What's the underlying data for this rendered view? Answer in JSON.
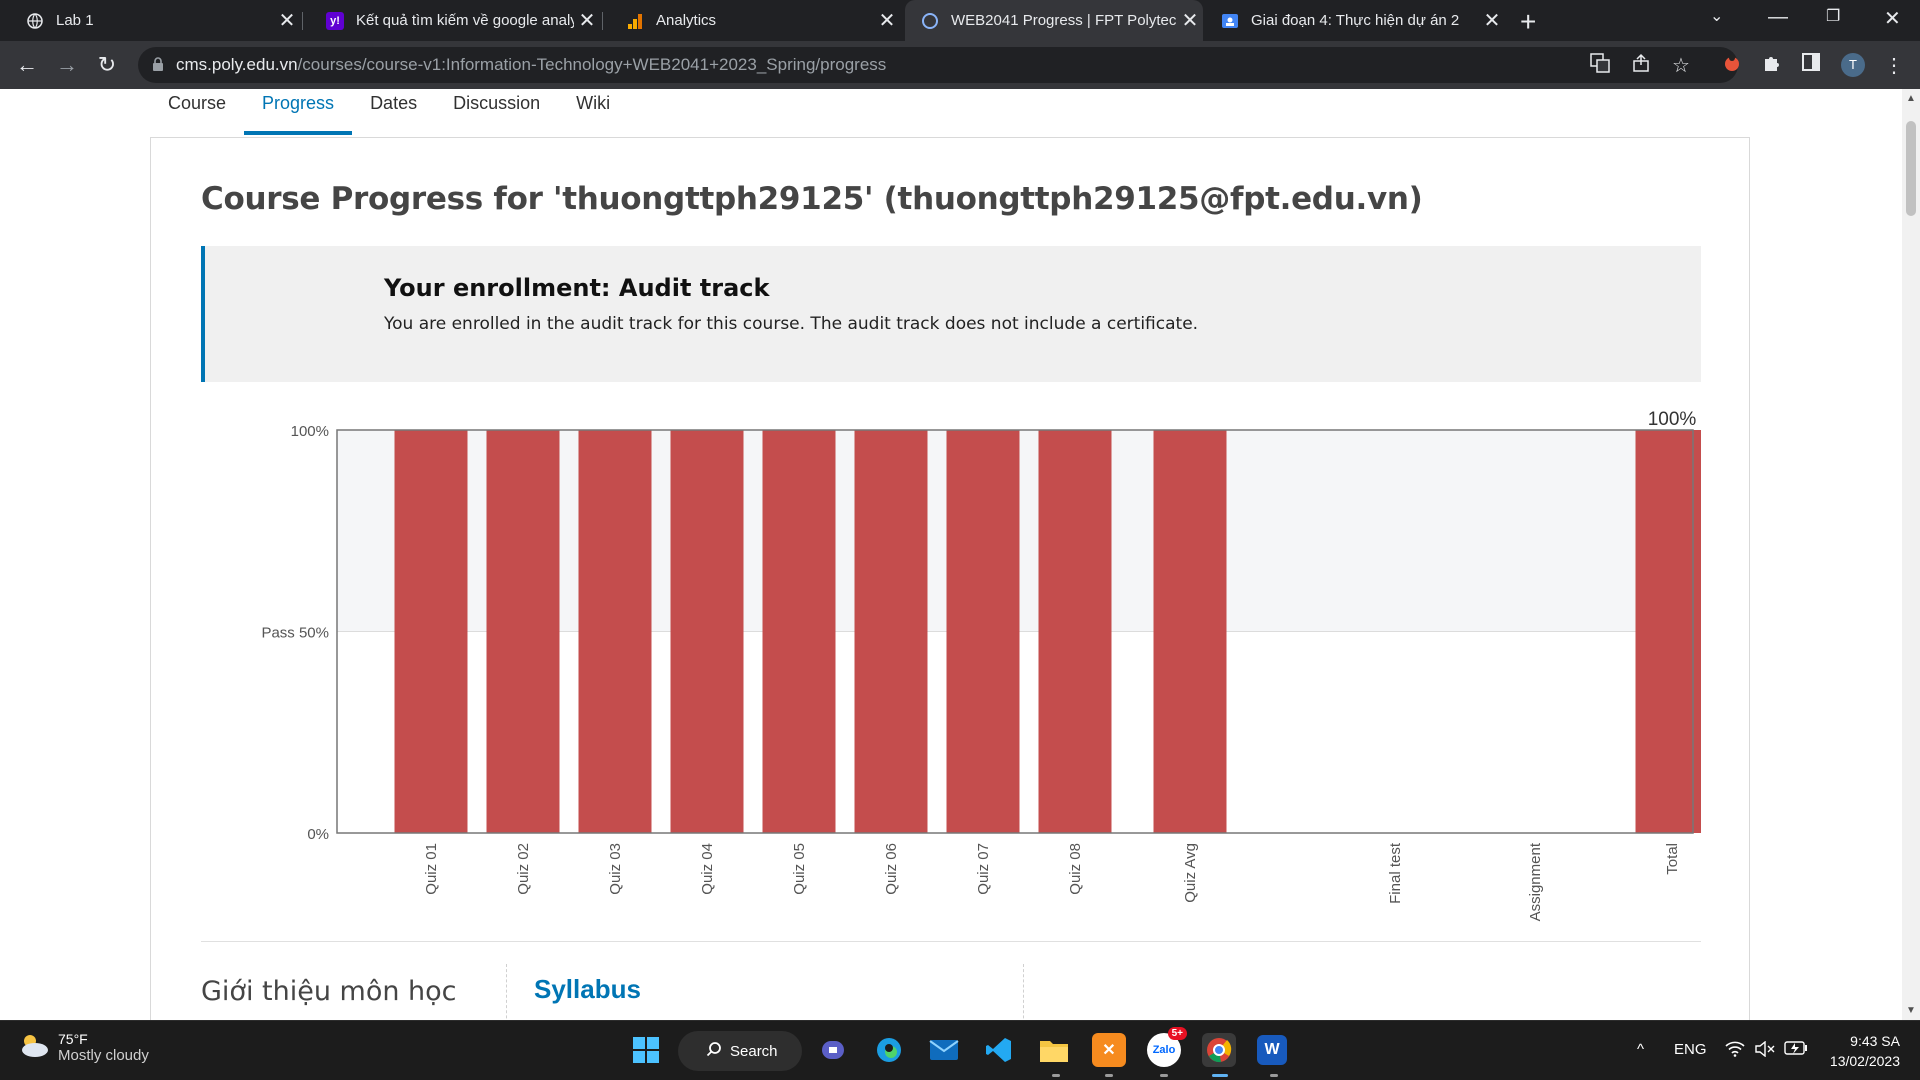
{
  "browser": {
    "tabs": [
      {
        "title": "Lab 1",
        "icon": "globe-icon"
      },
      {
        "title": "Kết quả tìm kiếm về google analy",
        "icon": "yahoo-icon"
      },
      {
        "title": "Analytics",
        "icon": "analytics-icon"
      },
      {
        "title": "WEB2041 Progress | FPT Polytech",
        "icon": "loading-icon",
        "active": true
      },
      {
        "title": "Giai đoạn 4: Thực hiện dự án 2",
        "icon": "classroom-icon"
      }
    ],
    "url_host": "cms.poly.edu.vn",
    "url_path": "/courses/course-v1:Information-Technology+WEB2041+2023_Spring/progress",
    "profile_initial": "T"
  },
  "course_nav": {
    "items": [
      "Course",
      "Progress",
      "Dates",
      "Discussion",
      "Wiki"
    ],
    "active": "Progress"
  },
  "main": {
    "heading": "Course Progress for 'thuongttph29125' (thuongttph29125@fpt.edu.vn)",
    "enrollment_title": "Your enrollment: Audit track",
    "enrollment_text": "You are enrolled in the audit track for this course. The audit track does not include a certificate.",
    "intro_label": "Giới thiệu môn học",
    "syllabus_label": "Syllabus"
  },
  "chart_data": {
    "type": "bar",
    "categories": [
      "Quiz 01",
      "Quiz 02",
      "Quiz 03",
      "Quiz 04",
      "Quiz 05",
      "Quiz 06",
      "Quiz 07",
      "Quiz 08",
      "Quiz Avg",
      "Final test",
      "Assignment",
      "Total"
    ],
    "values": [
      100,
      100,
      100,
      100,
      100,
      100,
      100,
      100,
      100,
      0,
      0,
      100
    ],
    "ylim": [
      0,
      100
    ],
    "yticks": [
      {
        "value": 0,
        "label": "0%"
      },
      {
        "value": 50,
        "label": "Pass 50%"
      },
      {
        "value": 100,
        "label": "100%"
      }
    ],
    "pass_threshold": 50,
    "total_label": "100%",
    "bar_color": "#c44d4d",
    "above_pass_bg": "#f5f6f8"
  },
  "taskbar": {
    "weather_temp": "75°F",
    "weather_cond": "Mostly cloudy",
    "search_label": "Search",
    "lang": "ENG",
    "time": "9:43 SA",
    "date": "13/02/2023",
    "zalo_badge": "5+"
  }
}
